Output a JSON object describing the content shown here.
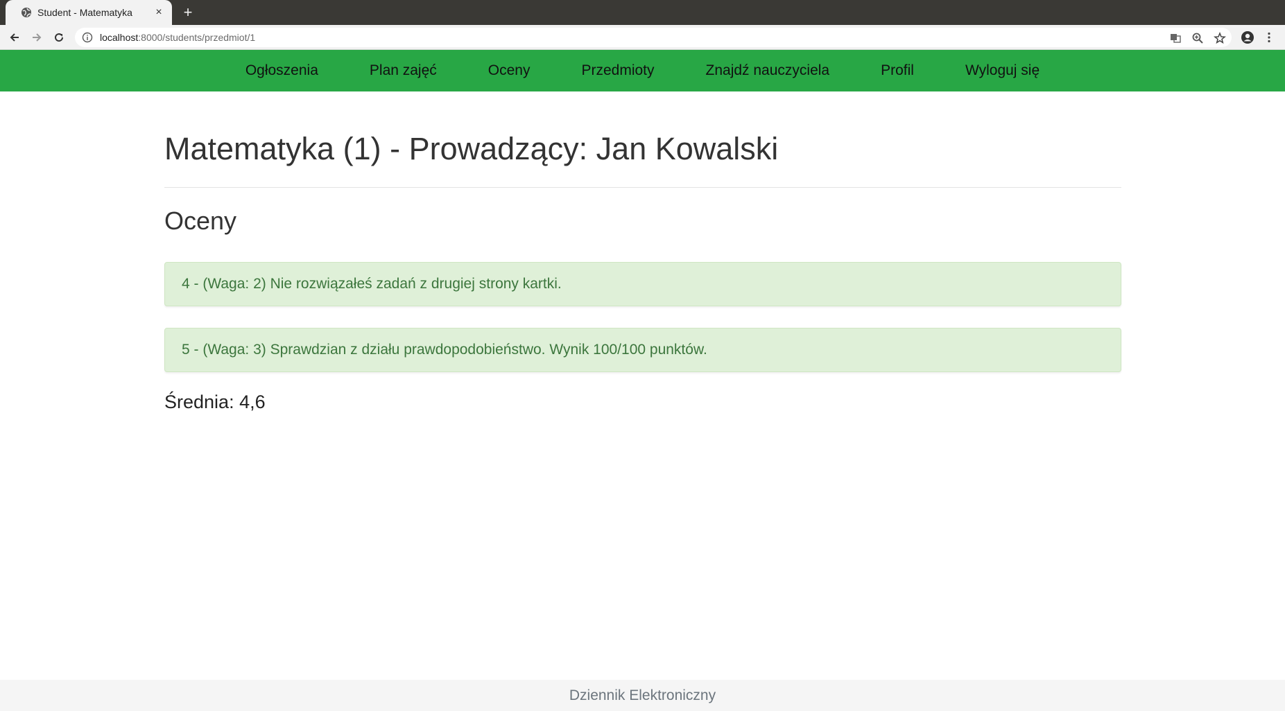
{
  "browser": {
    "tab_title": "Student - Matematyka",
    "tab_close": "×",
    "new_tab": "+",
    "url_host": "localhost",
    "url_path": ":8000/students/przedmiot/1"
  },
  "nav": {
    "items": [
      "Ogłoszenia",
      "Plan zajęć",
      "Oceny",
      "Przedmioty",
      "Znajdź nauczyciela",
      "Profil",
      "Wyloguj się"
    ],
    "bg_color": "#28a745"
  },
  "main": {
    "title": "Matematyka (1) - Prowadzący: Jan Kowalski",
    "section_title": "Oceny",
    "grades": [
      "4 - (Waga: 2) Nie rozwiązałeś zadań z drugiej strony kartki.",
      "5 - (Waga: 3) Sprawdzian z działu prawdopodobieństwo. Wynik 100/100 punktów."
    ],
    "average": "Średnia: 4,6"
  },
  "footer": {
    "text": "Dziennik Elektroniczny"
  }
}
